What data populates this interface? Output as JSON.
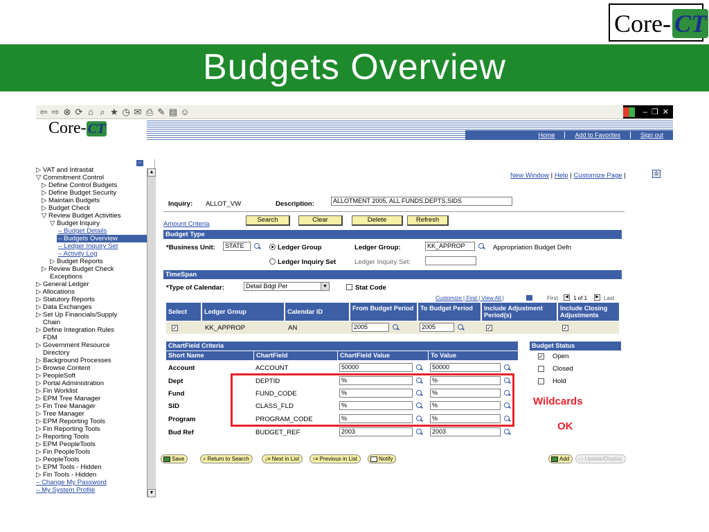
{
  "slide": {
    "title": "Budgets Overview",
    "logo_text": "Core-",
    "logo_ct": "CT",
    "annotation_line1": "Wildcards",
    "annotation_line2": "OK",
    "brand_green": "#1e8a2c",
    "accent_red": "#e8202a"
  },
  "app": {
    "logo_text": "Core-",
    "logo_ct": "CT",
    "nav_links": [
      "Home",
      "Add to Favorites",
      "Sign out"
    ],
    "accent_blue": "#3d5fa6"
  },
  "leftnav": {
    "items": [
      {
        "label": "▷ VAT and Intrastat"
      },
      {
        "label": "▽ Commitment Control"
      },
      {
        "label": "▷ Define Control Budgets"
      },
      {
        "label": "▷ Define Budget Security"
      },
      {
        "label": "▷ Maintain Budgets"
      },
      {
        "label": "▷ Budget Check"
      },
      {
        "label": "▽ Review Budget Activities"
      },
      {
        "label": "▽ Budget Inquiry"
      },
      {
        "label": "– Budget Details"
      },
      {
        "label": "– Budgets Overview"
      },
      {
        "label": "– Ledger Inquiry Set"
      },
      {
        "label": "– Activity Log"
      },
      {
        "label": "▷ Budget Reports"
      },
      {
        "label": "▷ Review Budget Check"
      },
      {
        "label": "Exceptions"
      },
      {
        "label": "▷ General Ledger"
      },
      {
        "label": "▷ Allocations"
      },
      {
        "label": "▷ Statutory Reports"
      },
      {
        "label": "▷ Data Exchanges"
      },
      {
        "label": "▷ Set Up Financials/Supply"
      },
      {
        "label": "Chain"
      },
      {
        "label": "▷ Define Integration Rules"
      },
      {
        "label": "FDM"
      },
      {
        "label": "▷ Government Resource"
      },
      {
        "label": "Directory"
      },
      {
        "label": "▷ Background Processes"
      },
      {
        "label": "▷ Browse Content"
      },
      {
        "label": "▷ PeopleSoft"
      },
      {
        "label": "▷ Portal Administration"
      },
      {
        "label": "▷ Fin Worklist"
      },
      {
        "label": "▷ EPM Tree Manager"
      },
      {
        "label": "▷ Fin Tree Manager"
      },
      {
        "label": "▷ Tree Manager"
      },
      {
        "label": "▷ EPM Reporting Tools"
      },
      {
        "label": "▷ Fin Reporting Tools"
      },
      {
        "label": "▷ Reporting Tools"
      },
      {
        "label": "▷ EPM PeopleTools"
      },
      {
        "label": "▷ Fin PeopleTools"
      },
      {
        "label": "▷ PeopleTools"
      },
      {
        "label": "▷ EPM Tools - Hidden"
      },
      {
        "label": "▷ Fin Tools - Hidden"
      },
      {
        "label": "– Change My Password"
      },
      {
        "label": "– My System Profile"
      }
    ]
  },
  "page": {
    "top_links": [
      "New Window",
      "Help",
      "Customize Page"
    ],
    "inquiry_label": "Inquiry:",
    "inquiry_value": "ALLOT_VW",
    "description_label": "Description:",
    "description_value": "ALLOTMENT 2005, ALL FUNDS,DEPTS,SIDS",
    "amount_criteria": "Amount Criteria",
    "buttons": {
      "search": "Search",
      "clear": "Clear",
      "delete": "Delete",
      "refresh": "Refresh"
    },
    "budget_type": {
      "header": "Budget Type",
      "business_unit_label": "*Business Unit:",
      "business_unit_value": "STATE",
      "ledger_group_radio": "Ledger Group",
      "ledger_inquiry_set_radio": "Ledger Inquiry Set",
      "ledger_group_label": "Ledger Group:",
      "ledger_group_value": "KK_APPROP",
      "ledger_group_desc": "Appropriation Budget Defn",
      "ledger_inquiry_set_label": "Ledger Inquiry Set:"
    },
    "timespan": {
      "header": "TimeSpan",
      "type_label": "*Type of Calendar:",
      "type_value": "Detail Bdgt Per",
      "stat_code": "Stat Code",
      "grid_links": "Customize | Find | View All |",
      "grid_nav": "First",
      "grid_count": "1 of 1",
      "grid_last": "Last",
      "columns": [
        "Select",
        "Ledger Group",
        "Calendar ID",
        "From Budget Period",
        "To Budget Period",
        "Include Adjustment Period(s)",
        "Include Closing Adjustments"
      ],
      "row": {
        "ledger_group": "KK_APPROP",
        "calendar_id": "AN",
        "from": "2005",
        "to": "2005"
      }
    },
    "chartfield": {
      "header": "ChartField Criteria",
      "columns": [
        "Short Name",
        "ChartField",
        "ChartField Value",
        "To Value"
      ],
      "rows": [
        {
          "short": "Account",
          "field": "ACCOUNT",
          "value": "50000",
          "to": "50000"
        },
        {
          "short": "Dept",
          "field": "DEPTID",
          "value": "%",
          "to": "%"
        },
        {
          "short": "Fund",
          "field": "FUND_CODE",
          "value": "%",
          "to": "%"
        },
        {
          "short": "SID",
          "field": "CLASS_FLD",
          "value": "%",
          "to": "%"
        },
        {
          "short": "Program",
          "field": "PROGRAM_CODE",
          "value": "%",
          "to": "%"
        },
        {
          "short": "Bud Ref",
          "field": "BUDGET_REF",
          "value": "2003",
          "to": "2003"
        }
      ]
    },
    "budget_status": {
      "header": "Budget Status",
      "options": [
        {
          "label": "Open",
          "checked": true
        },
        {
          "label": "Closed",
          "checked": false
        },
        {
          "label": "Hold",
          "checked": false
        }
      ]
    },
    "actions": {
      "save": "Save",
      "return": "Return to Search",
      "next": "Next in List",
      "previous": "Previous in List",
      "notify": "Notify",
      "add": "Add",
      "update": "Update/Display"
    }
  }
}
